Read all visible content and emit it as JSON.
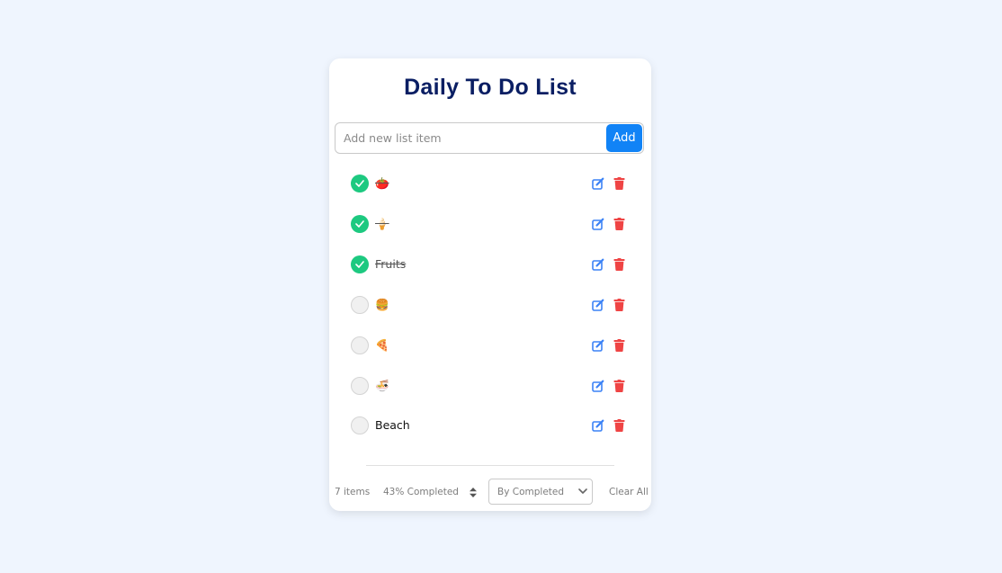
{
  "header": {
    "title": "Daily To Do List"
  },
  "add_form": {
    "placeholder": "Add new list item",
    "add_label": "Add",
    "value": ""
  },
  "items": [
    {
      "label": "🍅",
      "completed": true
    },
    {
      "label": "🍦",
      "completed": true
    },
    {
      "label": "Fruits",
      "completed": true
    },
    {
      "label": "🍔",
      "completed": false
    },
    {
      "label": "🍕",
      "completed": false
    },
    {
      "label": "🍜",
      "completed": false
    },
    {
      "label": "Beach",
      "completed": false
    }
  ],
  "footer": {
    "count": "7 items",
    "progress": "43% Completed",
    "filter_selected": "By Completed",
    "clear_label": "Clear All"
  },
  "colors": {
    "title": "#0a1e63",
    "accent": "#1183f6",
    "checked": "#1dc980",
    "edit": "#3b82f6",
    "delete": "#ef4444",
    "background": "#eff5fe"
  },
  "icons": {
    "check": "check-icon",
    "edit": "edit-icon",
    "delete": "trash-icon",
    "sort": "sort-icon",
    "dropdown": "chevron-down-icon"
  }
}
